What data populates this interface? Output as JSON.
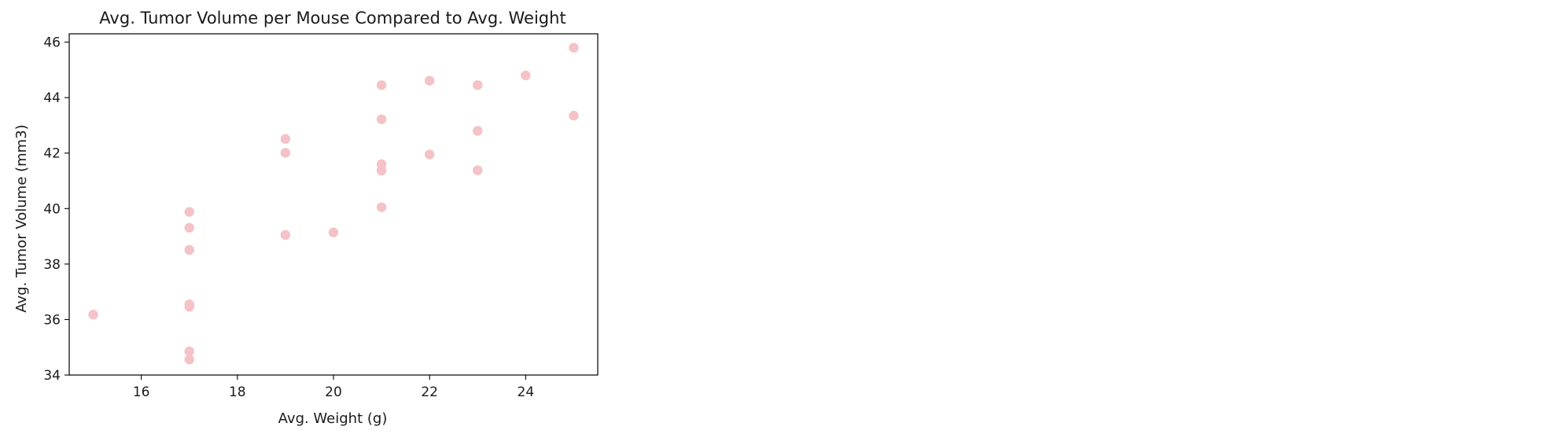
{
  "chart_data": {
    "type": "scatter",
    "title": "Avg. Tumor Volume per Mouse Compared to Avg. Weight",
    "xlabel": "Avg. Weight (g)",
    "ylabel": "Avg. Tumor Volume (mm3)",
    "xlim": [
      14.5,
      25.5
    ],
    "ylim": [
      34,
      46.3
    ],
    "xticks": [
      16,
      18,
      20,
      22,
      24
    ],
    "yticks": [
      34,
      36,
      38,
      40,
      42,
      44,
      46
    ],
    "grid": false,
    "point_color": "#f4c2c7",
    "points": [
      {
        "x": 15,
        "y": 36.18
      },
      {
        "x": 17,
        "y": 39.88
      },
      {
        "x": 17,
        "y": 39.31
      },
      {
        "x": 17,
        "y": 38.51
      },
      {
        "x": 17,
        "y": 36.55
      },
      {
        "x": 17,
        "y": 36.46
      },
      {
        "x": 17,
        "y": 34.85
      },
      {
        "x": 17,
        "y": 34.56
      },
      {
        "x": 19,
        "y": 42.51
      },
      {
        "x": 19,
        "y": 42.01
      },
      {
        "x": 19,
        "y": 39.05
      },
      {
        "x": 20,
        "y": 39.14
      },
      {
        "x": 21,
        "y": 44.45
      },
      {
        "x": 21,
        "y": 43.22
      },
      {
        "x": 21,
        "y": 41.6
      },
      {
        "x": 21,
        "y": 41.37
      },
      {
        "x": 21,
        "y": 40.05
      },
      {
        "x": 22,
        "y": 44.61
      },
      {
        "x": 22,
        "y": 41.95
      },
      {
        "x": 23,
        "y": 44.45
      },
      {
        "x": 23,
        "y": 42.8
      },
      {
        "x": 23,
        "y": 41.38
      },
      {
        "x": 24,
        "y": 44.8
      },
      {
        "x": 25,
        "y": 45.8
      },
      {
        "x": 25,
        "y": 43.35
      }
    ]
  }
}
